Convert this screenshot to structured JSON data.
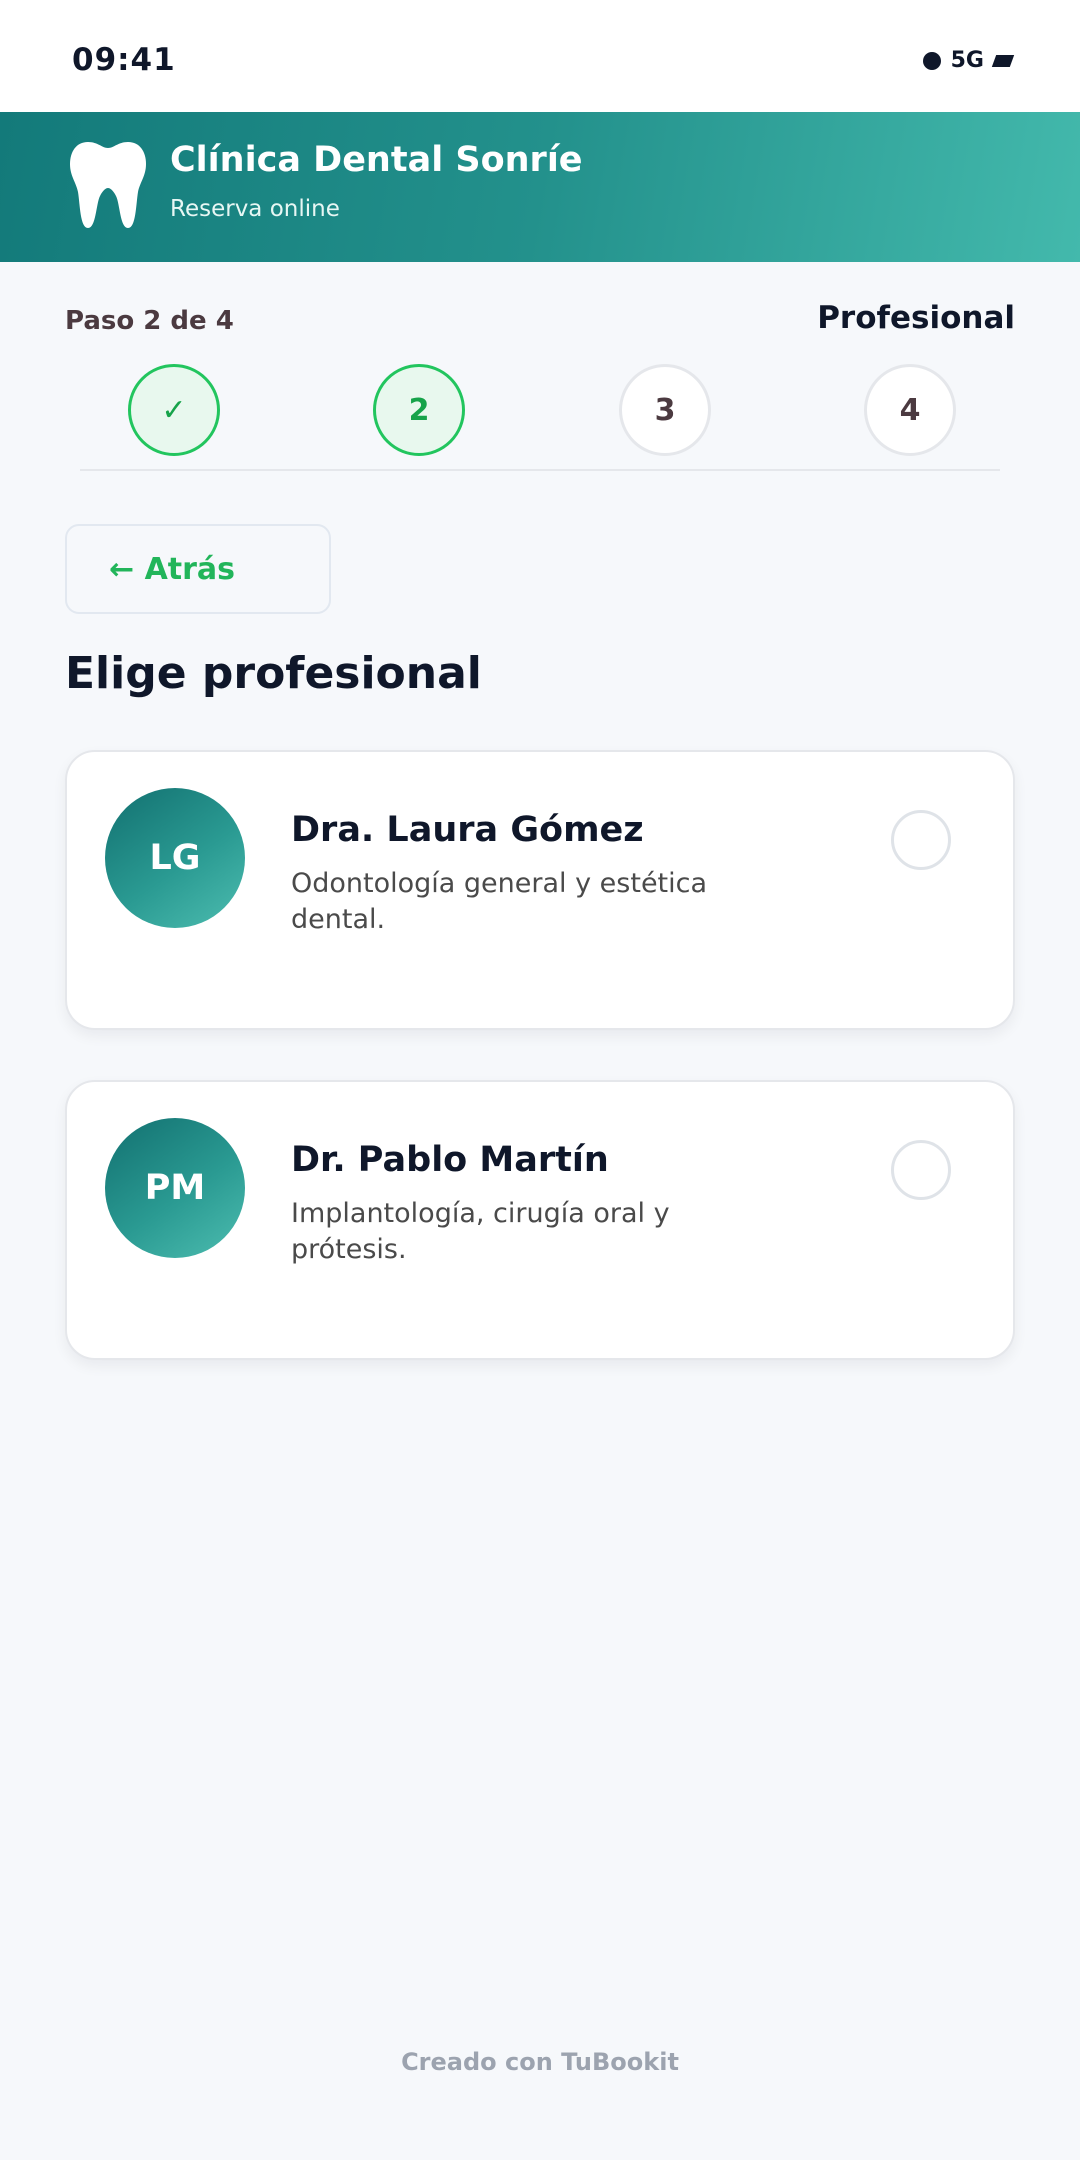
{
  "status_bar": {
    "time": "09:41",
    "network": "5G"
  },
  "header": {
    "title": "Clínica Dental Sonríe",
    "subtitle": "Reserva online"
  },
  "progress": {
    "step_label": "Paso 2 de 4",
    "step_name": "Profesional",
    "steps": [
      {
        "label": "✓",
        "state": "done"
      },
      {
        "label": "2",
        "state": "current"
      },
      {
        "label": "3",
        "state": "pending"
      },
      {
        "label": "4",
        "state": "pending"
      }
    ]
  },
  "back_button": {
    "label": "← Atrás"
  },
  "section_title": "Elige profesional",
  "professionals": [
    {
      "initials": "LG",
      "name": "Dra. Laura Gómez",
      "description": "Odontología general y estética dental.",
      "selected": false
    },
    {
      "initials": "PM",
      "name": "Dr. Pablo Martín",
      "description": "Implantología, cirugía oral y prótesis.",
      "selected": false
    }
  ],
  "footer": "Creado con TuBookit",
  "colors": {
    "accent": "#22c55e",
    "brand": "#1f8a85",
    "text": "#0f172a"
  },
  "icons": {
    "header": "tooth-icon",
    "status": [
      "dot-icon",
      "battery-icon"
    ]
  }
}
